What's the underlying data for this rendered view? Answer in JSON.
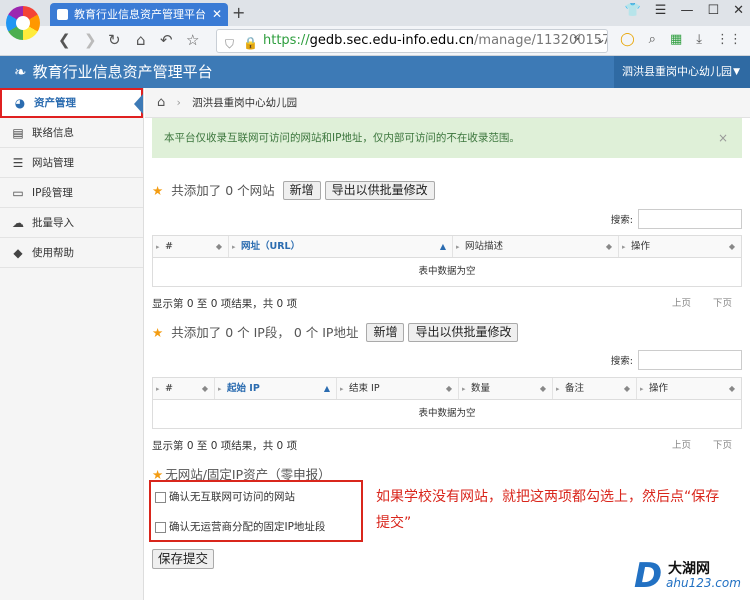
{
  "browser": {
    "tab_title": "教育行业信息资产管理平台",
    "url_https": "https://",
    "url_host": "gedb.sec.edu-info.edu.cn",
    "url_path": "/manage/113200157"
  },
  "header": {
    "title": "教育行业信息资产管理平台",
    "org": "泗洪县重岗中心幼儿园"
  },
  "sidebar": {
    "items": [
      {
        "label": "资产管理",
        "icon": "dashboard-icon"
      },
      {
        "label": "联络信息",
        "icon": "contact-card-icon"
      },
      {
        "label": "网站管理",
        "icon": "list-icon"
      },
      {
        "label": "IP段管理",
        "icon": "monitor-icon"
      },
      {
        "label": "批量导入",
        "icon": "cloud-upload-icon"
      },
      {
        "label": "使用帮助",
        "icon": "tag-icon"
      }
    ]
  },
  "breadcrumb": {
    "current": "泗洪县重岗中心幼儿园"
  },
  "alert": {
    "text": "本平台仅收录互联网可访问的网站和IP地址，仅内部可访问的不在收录范围。",
    "close": "×"
  },
  "websites": {
    "summary_pre": "共添加了",
    "count": "0",
    "summary_post": "个网站",
    "add_label": "新增",
    "export_label": "导出以供批量修改",
    "search_label": "搜索:",
    "columns": [
      "#",
      "网址（URL）",
      "网站描述",
      "操作"
    ],
    "empty": "表中数据为空",
    "info": "显示第 0 至 0 项结果，共 0 项",
    "prev": "上页",
    "next": "下页"
  },
  "ipranges": {
    "summary_pre": "共添加了",
    "count": "0",
    "summary_mid": "个 IP段，",
    "ip_count": "0",
    "summary_post": "个 IP地址",
    "add_label": "新增",
    "export_label": "导出以供批量修改",
    "search_label": "搜索:",
    "columns": [
      "#",
      "起始 IP",
      "结束 IP",
      "数量",
      "备注",
      "操作"
    ],
    "empty": "表中数据为空",
    "info": "显示第 0 至 0 项结果，共 0 项",
    "prev": "上页",
    "next": "下页"
  },
  "claim": {
    "title": "无网站/固定IP资产（零申报）",
    "no_website": "确认无互联网可访问的网站",
    "no_fixed_ip": "确认无运营商分配的固定IP地址段",
    "save_label": "保存提交"
  },
  "annotation": "如果学校没有网站，就把这两项都勾选上，然后点“保存提交”",
  "watermark": {
    "logo": "D",
    "name": "大湖网",
    "url": "ahu123.com"
  }
}
